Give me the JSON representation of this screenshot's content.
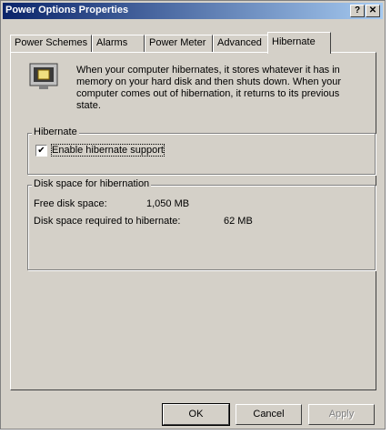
{
  "window": {
    "title": "Power Options Properties",
    "help_label": "?",
    "close_label": "✕"
  },
  "tabs": [
    {
      "label": "Power Schemes"
    },
    {
      "label": "Alarms"
    },
    {
      "label": "Power Meter"
    },
    {
      "label": "Advanced"
    },
    {
      "label": "Hibernate"
    }
  ],
  "hibernate": {
    "description": "When your computer hibernates, it stores whatever it has in memory on your hard disk and then shuts down. When your computer comes out of hibernation, it returns to its previous state.",
    "group_label": "Hibernate",
    "checkbox_label": "Enable hibernate support",
    "checkbox_checked": true
  },
  "disk": {
    "group_label": "Disk space for hibernation",
    "free_label": "Free disk space:",
    "free_value": "1,050 MB",
    "required_label": "Disk space required to hibernate:",
    "required_value": "62 MB"
  },
  "buttons": {
    "ok": "OK",
    "cancel": "Cancel",
    "apply": "Apply"
  },
  "icon": "computer-hibernate-icon"
}
